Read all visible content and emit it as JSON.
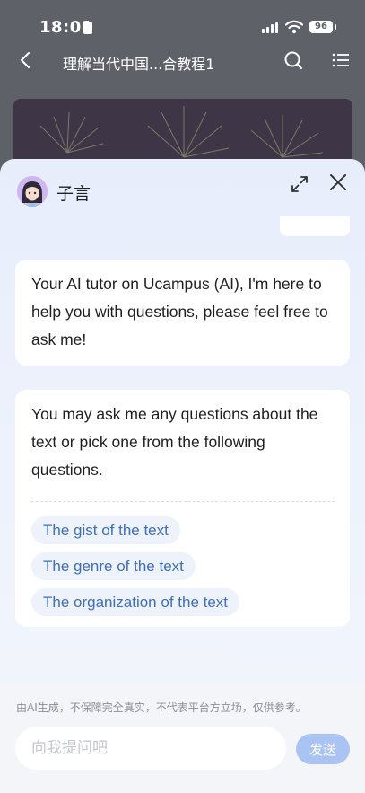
{
  "status_bar": {
    "time": "18:01",
    "battery": "96"
  },
  "nav": {
    "title": "理解当代中国...合教程1"
  },
  "assistant": {
    "name": "子言",
    "messages": [
      "Your AI tutor on Ucampus (AI), I'm here to help you with questions, please feel free to ask me!",
      "You may ask me any questions about the text or pick one from the following questions."
    ],
    "suggestions": [
      "The gist of the text",
      "The genre of the text",
      "The organization of the text"
    ]
  },
  "footer": {
    "disclaimer": "由AI生成，不保障完全真实，不代表平台方立场，仅供参考。",
    "input_placeholder": "向我提问吧",
    "send_label": "发送"
  },
  "colors": {
    "accent": "#3e6fb6",
    "send_button": "#a9c3f2",
    "chip_background": "#eef2fb"
  }
}
